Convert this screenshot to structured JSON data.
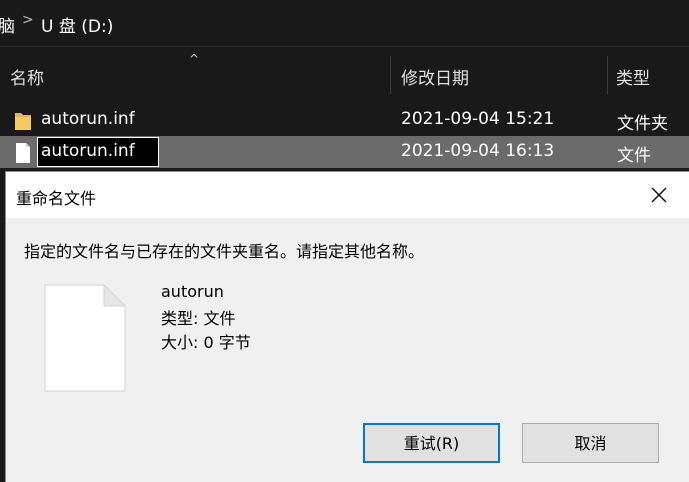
{
  "address": {
    "prev_segment": "脑",
    "separator": ">",
    "current": "U 盘 (D:)"
  },
  "columns": {
    "sort_indicator": "^",
    "name": "名称",
    "date": "修改日期",
    "type": "类型"
  },
  "rows": [
    {
      "icon": "folder-icon",
      "name": "autorun.inf",
      "date": "2021-09-04 15:21",
      "type": "文件夹"
    },
    {
      "icon": "file-icon",
      "name": "autorun.inf",
      "date": "2021-09-04 16:13",
      "type": "文件",
      "selected": true
    }
  ],
  "dialog": {
    "title": "重命名文件",
    "message": "指定的文件名与已存在的文件夹重名。请指定其他名称。",
    "file_name": "autorun",
    "type_line": "类型: 文件",
    "size_line": "大小: 0 字节",
    "retry_label": "重试(R)",
    "cancel_label": "取消"
  },
  "colors": {
    "explorer_bg": "#191919",
    "selected_row": "#6b6b6b",
    "dialog_bg": "#f0f0f0",
    "accent": "#0078d7"
  }
}
